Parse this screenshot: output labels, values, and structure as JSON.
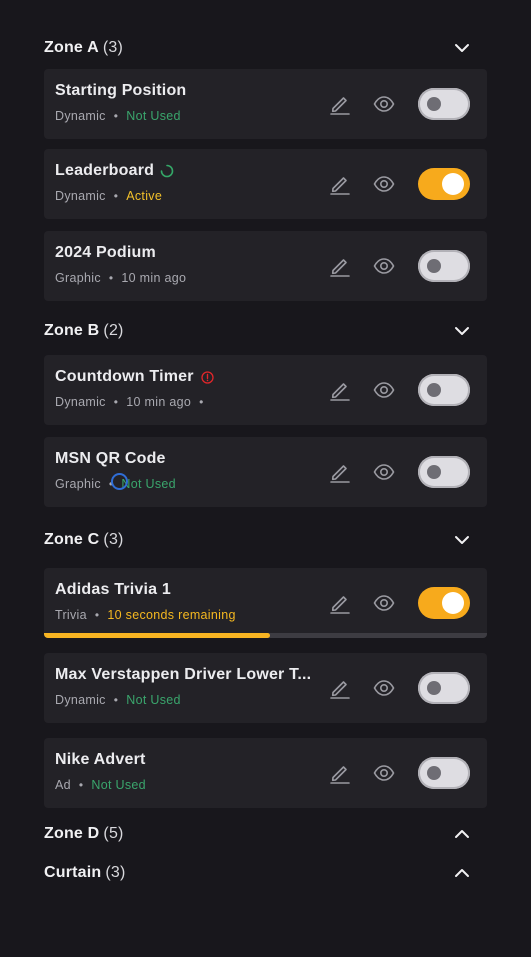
{
  "zones": {
    "a": {
      "title": "Zone A",
      "count": "(3)"
    },
    "b": {
      "title": "Zone B",
      "count": "(2)"
    },
    "c": {
      "title": "Zone C",
      "count": "(3)"
    },
    "d": {
      "title": "Zone D",
      "count": "(5)"
    },
    "curtain": {
      "title": "Curtain",
      "count": "(3)"
    }
  },
  "items": [
    {
      "title": "Starting Position",
      "type": "Dynamic",
      "status": "Not Used",
      "enabled": false
    },
    {
      "title": "Leaderboard",
      "type": "Dynamic",
      "status": "Active",
      "enabled": true
    },
    {
      "title": "2024 Podium",
      "type": "Graphic",
      "status": "10 min ago",
      "enabled": false
    },
    {
      "title": "Countdown Timer",
      "type": "Dynamic",
      "status": "10 min ago",
      "enabled": false
    },
    {
      "title": "MSN QR Code",
      "type": "Graphic",
      "status": "Not Used",
      "enabled": false
    },
    {
      "title": "Adidas Trivia 1",
      "type": "Trivia",
      "status": "10 seconds remaining",
      "enabled": true,
      "progress": 0.51
    },
    {
      "title": "Max Verstappen Driver Lower T...",
      "type": "Dynamic",
      "status": "Not Used",
      "enabled": false
    },
    {
      "title": "Nike Advert",
      "type": "Ad",
      "status": "Not Used",
      "enabled": false
    }
  ],
  "colors": {
    "background": "#18171c",
    "card": "#232227",
    "accent": "#f7aa1c",
    "status_green": "#3aa56c",
    "status_yellow": "#f2c02a",
    "error": "#e0262a"
  },
  "icons": [
    "chevron-down-icon",
    "chevron-up-icon",
    "edit-pencil-icon",
    "eye-icon",
    "loading-spinner-icon",
    "error-alert-icon"
  ]
}
